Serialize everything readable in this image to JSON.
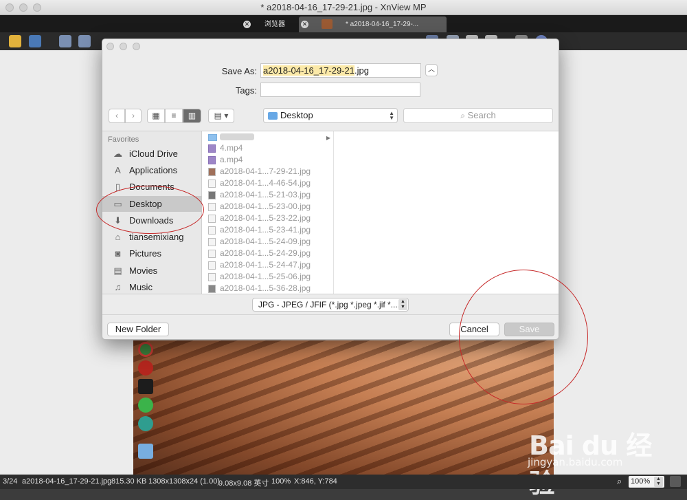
{
  "window": {
    "title": "* a2018-04-16_17-29-21.jpg - XnView MP"
  },
  "tabs": [
    {
      "label": "浏览器"
    },
    {
      "label": "* a2018-04-16_17-29-..."
    }
  ],
  "dialog": {
    "save_as_label": "Save As:",
    "save_as_selected": "a2018-04-16_17-29-21",
    "save_as_extension": ".jpg",
    "tags_label": "Tags:",
    "tags_value": "",
    "location": "Desktop",
    "search_placeholder": "Search",
    "sidebar_header": "Favorites",
    "sidebar_items": [
      {
        "label": "iCloud Drive",
        "icon": "cloud-icon"
      },
      {
        "label": "Applications",
        "icon": "applications-icon"
      },
      {
        "label": "Documents",
        "icon": "document-icon"
      },
      {
        "label": "Desktop",
        "icon": "desktop-icon",
        "selected": true
      },
      {
        "label": "Downloads",
        "icon": "downloads-icon"
      },
      {
        "label": "tiansemixiang",
        "icon": "home-icon"
      },
      {
        "label": "Pictures",
        "icon": "camera-icon"
      },
      {
        "label": "Movies",
        "icon": "film-icon"
      },
      {
        "label": "Music",
        "icon": "music-icon"
      }
    ],
    "files": [
      "4.mp4",
      "a.mp4",
      "a2018-04-1...7-29-21.jpg",
      "a2018-04-1...4-46-54.jpg",
      "a2018-04-1...5-21-03.jpg",
      "a2018-04-1...5-23-00.jpg",
      "a2018-04-1...5-23-22.jpg",
      "a2018-04-1...5-23-41.jpg",
      "a2018-04-1...5-24-09.jpg",
      "a2018-04-1...5-24-29.jpg",
      "a2018-04-1...5-24-47.jpg",
      "a2018-04-1...5-25-06.jpg",
      "a2018-04-1...5-36-28.jpg"
    ],
    "format": "JPG - JPEG / JFIF (*.jpg *.jpeg *.jif *....",
    "new_folder_label": "New Folder",
    "cancel_label": "Cancel",
    "save_label": "Save"
  },
  "status": {
    "index": "3/24",
    "filename": "a2018-04-16_17-29-21.jpg",
    "filesize": "815.30 KB",
    "dimensions": "1308x1308x24 (1.00)",
    "print_size": "9.08x9.08 英寸",
    "zoom_pct": "100%",
    "coords": "X:846, Y:784",
    "zoom_box": "100%"
  },
  "watermark": {
    "brand": "Bai du 经验",
    "sub": "jingyan.baidu.com"
  },
  "colors": {
    "annotation": "#c62828",
    "selection": "#fbe9a8",
    "sidebar_active": "#c9c9c9"
  }
}
